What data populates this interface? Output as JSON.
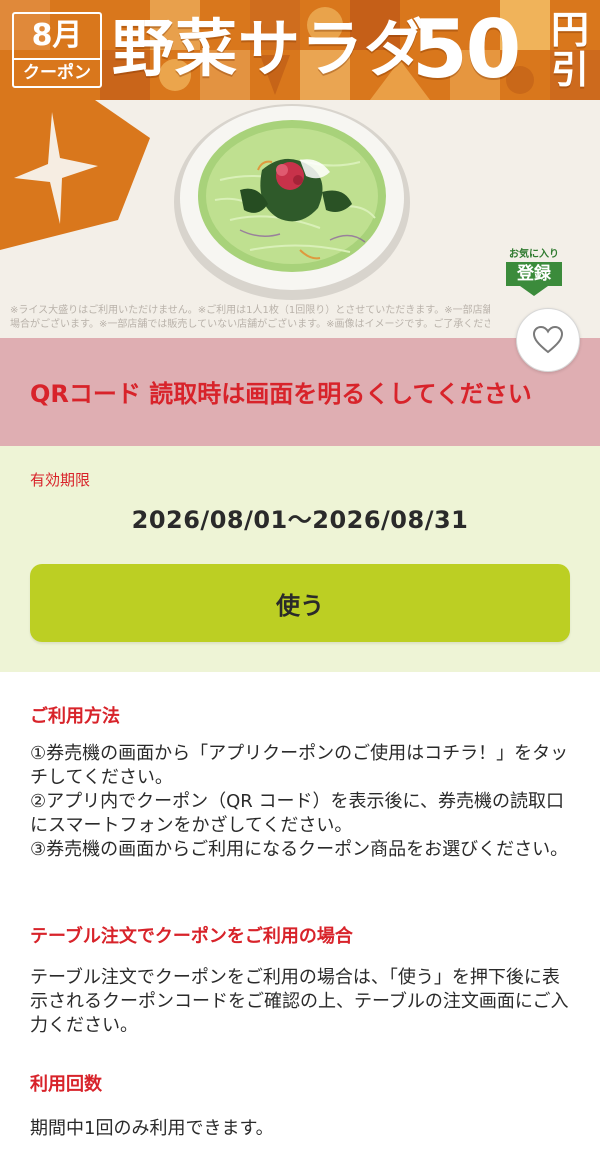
{
  "banner": {
    "month": "8月",
    "month_sub": "クーポン",
    "product_name": "野菜サラダ",
    "discount_amount": "50",
    "discount_unit_top": "円",
    "discount_unit_bottom": "引"
  },
  "photo": {
    "favorite_badge_top": "お気に入り",
    "favorite_badge_main": "登録",
    "disclaimer_line1": "※ライス大盛りはご利用いただけません。※ご利用は1人1枚（1回限り）とさせていただきます。※一部店舗では価格が異なる",
    "disclaimer_line2": "場合がございます。※一部店舗では販売していない店舗がございます。※画像はイメージです。ご了承ください。"
  },
  "qr_notice": {
    "text": "QRコード 読取時は画面を明るくしてください"
  },
  "validity": {
    "label": "有効期限",
    "dates": "2026/08/01〜2026/08/31",
    "use_button": "使う"
  },
  "sections": {
    "usage": {
      "title": "ご利用方法",
      "steps": [
        "①券売機の画面から「アプリクーポンのご使用はコチラ！」をタッチしてください。",
        "②アプリ内でクーポン（QR コード）を表示後に、券売機の読取口にスマートフォンをかざしてください。",
        "③券売機の画面からご利用になるクーポン商品をお選びください。"
      ]
    },
    "table_order": {
      "title": "テーブル注文でクーポンをご利用の場合",
      "body": "テーブル注文でクーポンをご利用の場合は、「使う」を押下後に表示されるクーポンコードをご確認の上、テーブルの注文画面にご入力ください。"
    },
    "usage_count": {
      "title": "利用回数",
      "body": "期間中1回のみ利用できます。"
    }
  },
  "colors": {
    "banner_orange": "#d9771c",
    "accent_red": "#d8232a",
    "notice_pink": "#dfaeb2",
    "validity_bg": "#eef4d6",
    "button_green": "#bccf23",
    "badge_green": "#3b8b3b"
  },
  "icons": {
    "favorite": "heart-icon",
    "decoration": "star-icon"
  }
}
